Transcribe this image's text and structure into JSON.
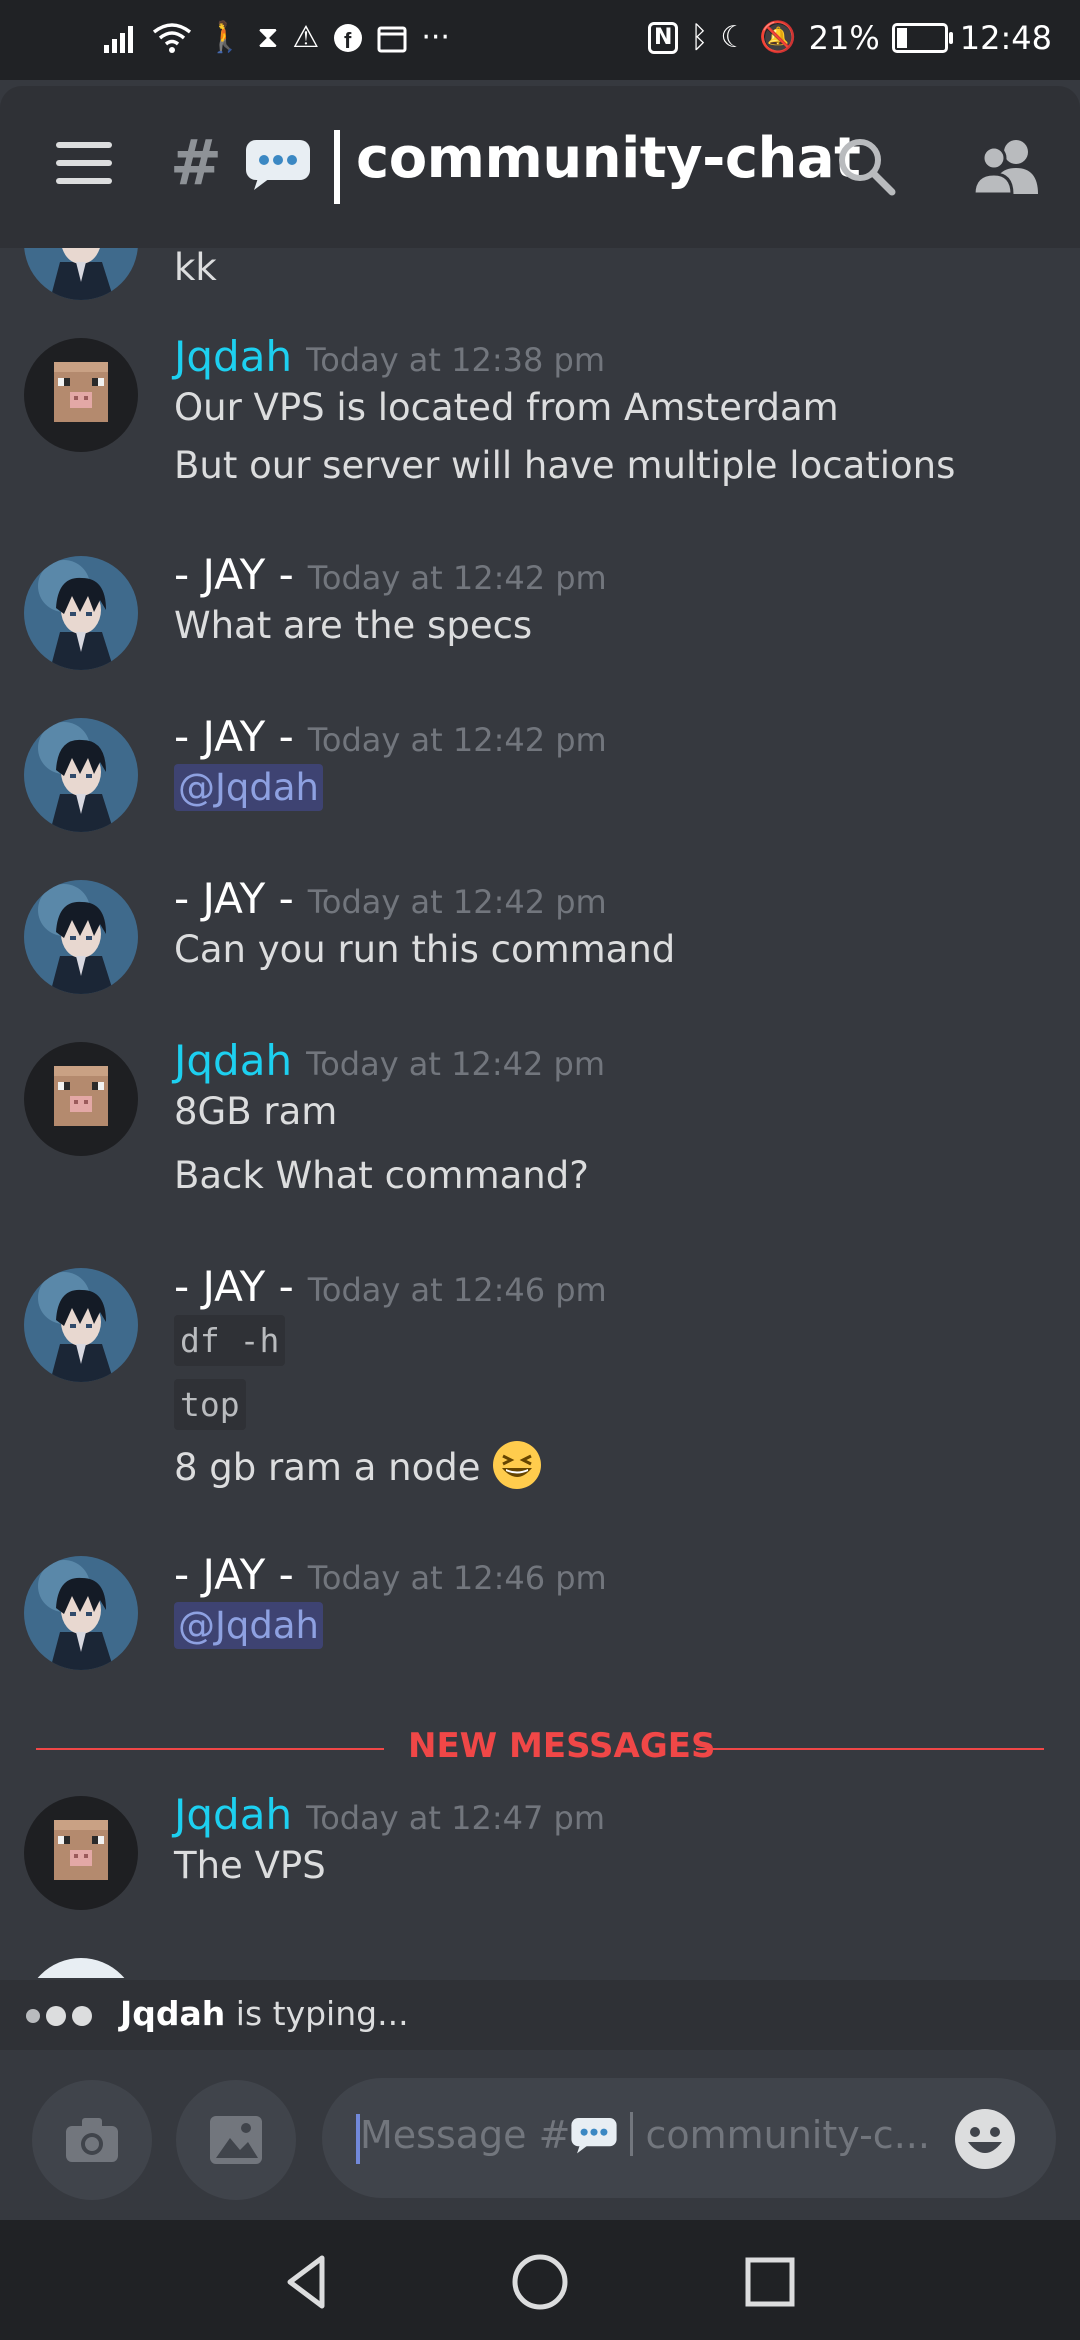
{
  "status_bar": {
    "battery": "21%",
    "battery_level": 0.21,
    "time": "12:48",
    "left_icons": [
      "signal-icon",
      "wifi-icon",
      "walking-icon",
      "hourglass-icon",
      "warning-icon",
      "facebook-icon",
      "calendar-icon",
      "more-icon"
    ],
    "right_icons": [
      "nfc-icon",
      "bluetooth-icon",
      "moon-icon",
      "bell-off-icon"
    ]
  },
  "header": {
    "hash": "#",
    "emoji": "💬",
    "channel_name": "community-chat"
  },
  "messages": [
    {
      "continuation": true,
      "lines": [
        {
          "type": "text",
          "text": "kk"
        }
      ]
    },
    {
      "author": "Jqdah",
      "author_type": "jq",
      "timestamp": "Today at 12:38 pm",
      "lines": [
        {
          "type": "text",
          "text": "Our VPS is located from Amsterdam"
        },
        {
          "type": "text",
          "text": "But our server will have multiple locations"
        }
      ]
    },
    {
      "author": "- JAY -",
      "author_type": "jay",
      "timestamp": "Today at 12:42 pm",
      "lines": [
        {
          "type": "text",
          "text": "What are the specs"
        }
      ]
    },
    {
      "author": "- JAY -",
      "author_type": "jay",
      "timestamp": "Today at 12:42 pm",
      "lines": [
        {
          "type": "mention",
          "text": "@Jqdah"
        }
      ]
    },
    {
      "author": "- JAY -",
      "author_type": "jay",
      "timestamp": "Today at 12:42 pm",
      "lines": [
        {
          "type": "text",
          "text": "Can you run this command"
        }
      ]
    },
    {
      "author": "Jqdah",
      "author_type": "jq",
      "timestamp": "Today at 12:42 pm",
      "lines": [
        {
          "type": "text",
          "text": "8GB ram"
        },
        {
          "type": "text",
          "text": "Back What command?"
        }
      ]
    },
    {
      "author": "- JAY -",
      "author_type": "jay",
      "timestamp": "Today at 12:46 pm",
      "lines": [
        {
          "type": "code",
          "text": "df -h"
        },
        {
          "type": "code",
          "text": "top"
        },
        {
          "type": "text",
          "text": "8 gb ram a node"
        }
      ],
      "emoji": "laughing-emoji"
    },
    {
      "author": "- JAY -",
      "author_type": "jay",
      "timestamp": "Today at 12:46 pm",
      "lines": [
        {
          "type": "mention",
          "text": "@Jqdah"
        }
      ]
    },
    {
      "author": "Jqdah",
      "author_type": "jq",
      "timestamp": "Today at 12:47 pm",
      "lines": [
        {
          "type": "text",
          "text": "The VPS"
        }
      ]
    }
  ],
  "new_messages_label": "NEW MESSAGES",
  "typing": {
    "user": "Jqdah",
    "text": " is typing..."
  },
  "composer": {
    "placeholder_prefix": "Message #",
    "placeholder_emoji": "💬",
    "placeholder_suffix": "community-c..."
  },
  "colors": {
    "background": "#36393f",
    "header": "#2f3136",
    "jqdah_name": "#1dd0f0",
    "jay_name": "#ffffff",
    "mention_bg": "#3e4372",
    "mention_text": "#8ea1e1",
    "new_messages": "#f04747"
  }
}
